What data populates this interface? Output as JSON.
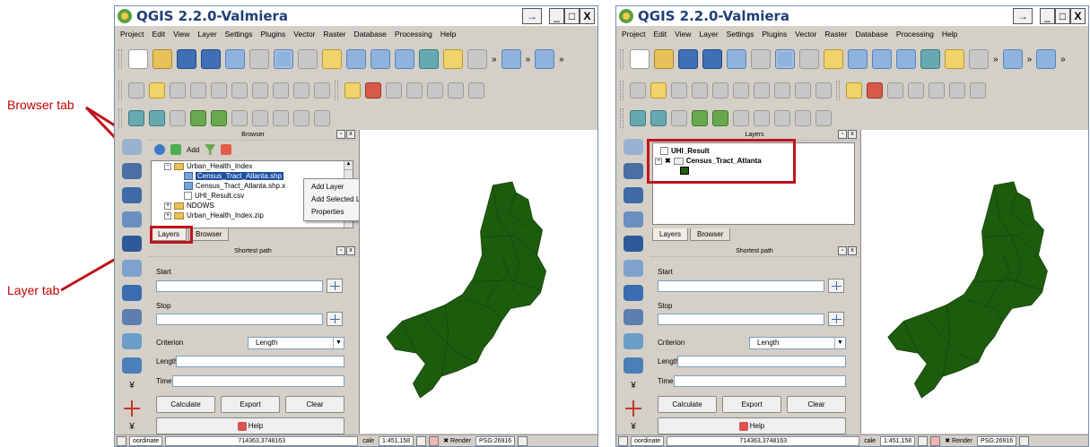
{
  "annotations": {
    "browser_tab": "Browser tab",
    "layer_tab": "Layer tab"
  },
  "colors": {
    "polygon_fill": "#1d5c0c",
    "highlight": "#c0141c",
    "annotation_text": "#c00000"
  },
  "app": {
    "title": "QGIS 2.2.0-Valmiera",
    "window_buttons": {
      "arrow": "→",
      "minimize": "_",
      "maximize": "□",
      "close": "X"
    },
    "menu": [
      "Project",
      "Edit",
      "View",
      "Layer",
      "Settings",
      "Plugins",
      "Vector",
      "Raster",
      "Database",
      "Processing",
      "Help"
    ]
  },
  "left": {
    "browser_panel": {
      "title": "Browser",
      "add_label": "Add",
      "tree": [
        {
          "label": "Urban_Health_Index",
          "icon": "folder-icon"
        },
        {
          "label": "Census_Tract_Atlanta.shp",
          "icon": "shapefile-icon",
          "selected": true
        },
        {
          "label": "Census_Tract_Atlanta.shp.x",
          "icon": "shapefile-icon"
        },
        {
          "label": "UHI_Result.csv",
          "icon": "csv-icon"
        },
        {
          "label": "NDOWS",
          "icon": "folder-icon"
        },
        {
          "label": "Urban_Health_Index.zip",
          "icon": "folder-icon"
        }
      ],
      "context_menu": [
        "Add Layer",
        "Add Selected Layers",
        "Properties"
      ]
    },
    "tabs": [
      "Layers",
      "Browser"
    ]
  },
  "right": {
    "layers_panel": {
      "title": "Layers",
      "items": [
        "UHI_Result",
        "Census_Tract_Atlanta"
      ]
    },
    "tabs": [
      "Layers",
      "Browser"
    ]
  },
  "shortest_path": {
    "title": "Shortest path",
    "start_label": "Start",
    "stop_label": "Stop",
    "criterion_label": "Criterion",
    "criterion_value": "Length",
    "length_label": "Length",
    "time_label": "Time",
    "calculate": "Calculate",
    "export": "Export",
    "clear": "Clear",
    "help": "Help"
  },
  "status": {
    "left": {
      "coordinate_label": "oordinate",
      "coordinate_value": "714363,3748163",
      "scale_label": "cale",
      "scale_value": "1:451,158",
      "render": "Render",
      "crs": "PSG:26916"
    },
    "right": {
      "coordinate_label": "oordinate",
      "coordinate_value": "714363,3748163",
      "scale_label": "cale",
      "scale_value": "1:451,158",
      "render": "Render",
      "crs": "PSG:26916"
    }
  }
}
